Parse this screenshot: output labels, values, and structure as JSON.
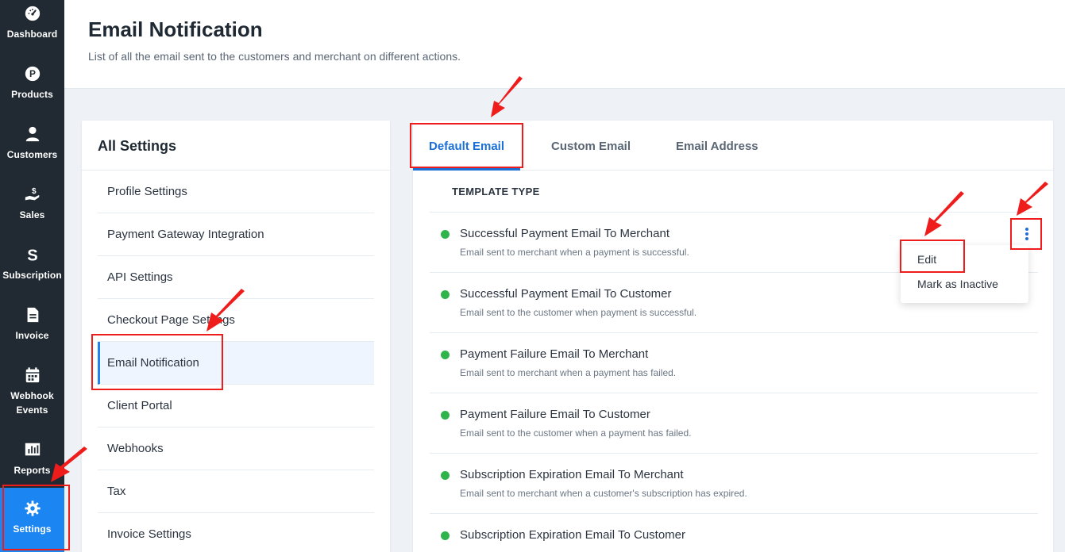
{
  "sidebar": {
    "items": [
      {
        "label": "Dashboard",
        "icon": "dashboard-icon"
      },
      {
        "label": "Products",
        "icon": "products-icon"
      },
      {
        "label": "Customers",
        "icon": "customers-icon"
      },
      {
        "label": "Sales",
        "icon": "sales-icon"
      },
      {
        "label": "Subscription",
        "icon": "subscription-icon"
      },
      {
        "label": "Invoice",
        "icon": "invoice-icon"
      },
      {
        "label": "Webhook Events",
        "icon": "calendar-icon"
      },
      {
        "label": "Reports",
        "icon": "reports-icon"
      },
      {
        "label": "Settings",
        "icon": "gear-icon",
        "active": true
      }
    ],
    "active_color": "#1b86f2"
  },
  "header": {
    "title": "Email Notification",
    "subtitle": "List of all the email sent to the customers and merchant on different actions."
  },
  "settings_panel": {
    "title": "All Settings",
    "items": [
      {
        "label": "Profile Settings"
      },
      {
        "label": "Payment Gateway Integration"
      },
      {
        "label": "API Settings"
      },
      {
        "label": "Checkout Page Settings"
      },
      {
        "label": "Email Notification",
        "active": true
      },
      {
        "label": "Client Portal"
      },
      {
        "label": "Webhooks"
      },
      {
        "label": "Tax"
      },
      {
        "label": "Invoice Settings"
      }
    ]
  },
  "tabs": [
    {
      "label": "Default Email",
      "active": true
    },
    {
      "label": "Custom Email"
    },
    {
      "label": "Email Address"
    }
  ],
  "table": {
    "column_header": "TEMPLATE TYPE",
    "rows": [
      {
        "name": "Successful Payment Email To Merchant",
        "description": "Email sent to merchant when a payment is successful.",
        "status_color": "#2fb34a"
      },
      {
        "name": "Successful Payment Email To Customer",
        "description": "Email sent to the customer when payment is successful.",
        "status_color": "#2fb34a"
      },
      {
        "name": "Payment Failure Email To Merchant",
        "description": "Email sent to merchant when a payment has failed.",
        "status_color": "#2fb34a"
      },
      {
        "name": "Payment Failure Email To Customer",
        "description": "Email sent to the customer when a payment has failed.",
        "status_color": "#2fb34a"
      },
      {
        "name": "Subscription Expiration Email To Merchant",
        "description": "Email sent to merchant when a customer's subscription has expired.",
        "status_color": "#2fb34a"
      },
      {
        "name": "Subscription Expiration Email To Customer",
        "description": "",
        "status_color": "#2fb34a"
      }
    ]
  },
  "row_menu": {
    "items": [
      {
        "label": "Edit"
      },
      {
        "label": "Mark as Inactive"
      }
    ]
  },
  "annotation_color": "#ef1c1c",
  "accent_color": "#1b6fd6"
}
